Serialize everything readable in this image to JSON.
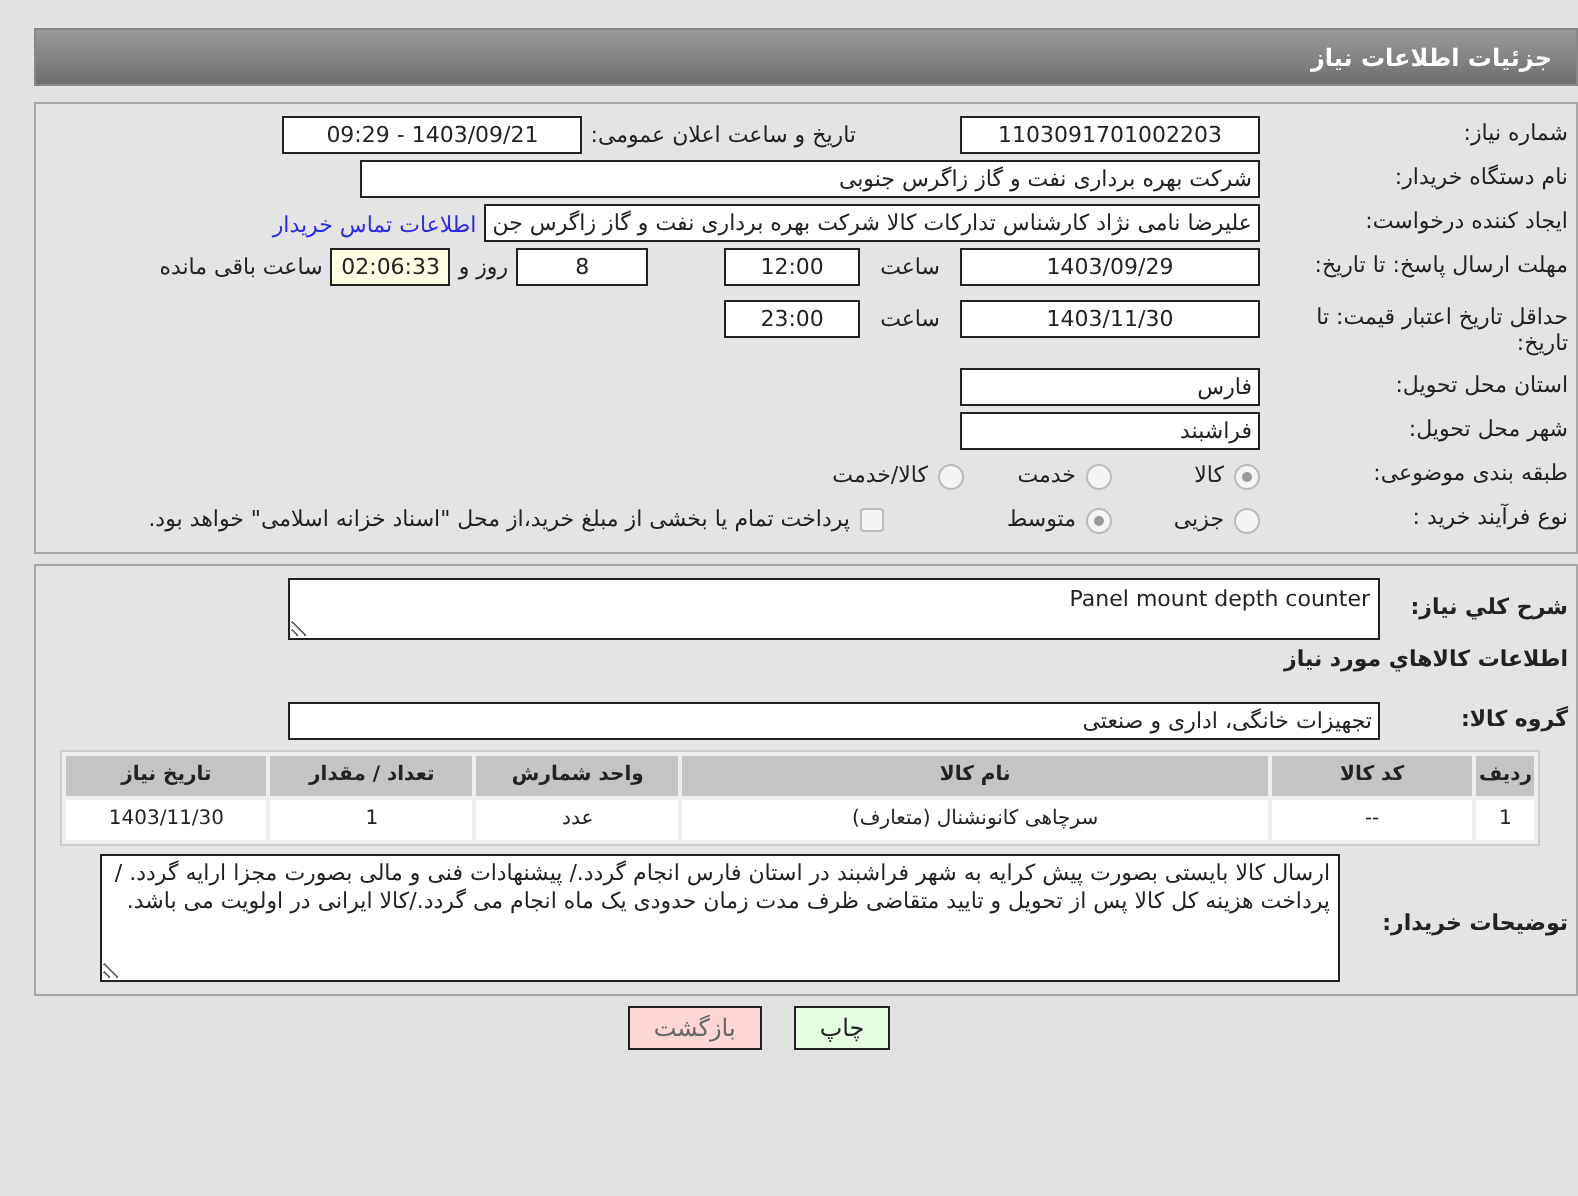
{
  "header": {
    "title": "جزئیات اطلاعات نیاز"
  },
  "need_number": {
    "label": "شماره نیاز:",
    "value": "1103091701002203"
  },
  "announce": {
    "label": "تاریخ و ساعت اعلان عمومی:",
    "value": "1403/09/21 - 09:29"
  },
  "buyer_org": {
    "label": "نام دستگاه خریدار:",
    "value": "شرکت بهره برداری نفت و گاز زاگرس جنوبی"
  },
  "requester": {
    "label": "ایجاد کننده درخواست:",
    "value": "علیرضا نامی نژاد کارشناس تداركات كالا شرکت بهره برداری نفت و گاز زاگرس جن",
    "link": "اطلاعات تماس خریدار"
  },
  "reply_deadline": {
    "label": "مهلت ارسال پاسخ: تا تاریخ:",
    "date": "1403/09/29",
    "time_label": "ساعت",
    "time": "12:00",
    "days": "8",
    "days_label": "روز و",
    "remaining": "02:06:33",
    "remaining_label": "ساعت باقی مانده"
  },
  "price_validity": {
    "label": "حداقل تاریخ اعتبار قیمت: تا تاریخ:",
    "date": "1403/11/30",
    "time_label": "ساعت",
    "time": "23:00"
  },
  "province": {
    "label": "استان محل تحویل:",
    "value": "فارس"
  },
  "city": {
    "label": "شهر محل تحویل:",
    "value": "فراشبند"
  },
  "category": {
    "label": "طبقه بندی موضوعی:",
    "options": [
      {
        "label": "کالا",
        "selected": true
      },
      {
        "label": "خدمت",
        "selected": false
      },
      {
        "label": "کالا/خدمت",
        "selected": false
      }
    ]
  },
  "process": {
    "label": "نوع فرآیند خرید :",
    "options": [
      {
        "label": "جزیی",
        "selected": false
      },
      {
        "label": "متوسط",
        "selected": true
      }
    ],
    "checkbox": {
      "label": "پرداخت تمام یا بخشی از مبلغ خرید،از محل \"اسناد خزانه اسلامی\" خواهد بود.",
      "checked": false
    }
  },
  "description": {
    "label": "شرح کلي نياز:",
    "value": "Panel mount depth counter"
  },
  "goods_title": "اطلاعات کالاهاي مورد نياز",
  "goods_group": {
    "label": "گروه کالا:",
    "value": "تجهیزات خانگی، اداری و صنعتی"
  },
  "table": {
    "columns": [
      "ردیف",
      "کد کالا",
      "نام کالا",
      "واحد شمارش",
      "تعداد / مقدار",
      "تاریخ نیاز"
    ],
    "rows": [
      [
        "1",
        "--",
        "سرچاهی کانونشنال (متعارف)",
        "عدد",
        "1",
        "1403/11/30"
      ]
    ]
  },
  "buyer_notes": {
    "label": "توضیحات خریدار:",
    "value": "ارسال کالا بایستی بصورت پیش کرایه به شهر فراشبند در استان فارس انجام گردد./ پیشنهادات فنی و مالی بصورت مجزا ارایه گردد. / پرداخت هزینه کل کالا پس از تحویل و تایید متقاضی ظرف مدت زمان حدودی یک ماه انجام می گردد./کالا ایرانی در اولویت می باشد."
  },
  "buttons": [
    {
      "label": "چاپ",
      "kind": "print"
    },
    {
      "label": "بازگشت",
      "kind": "back"
    }
  ]
}
